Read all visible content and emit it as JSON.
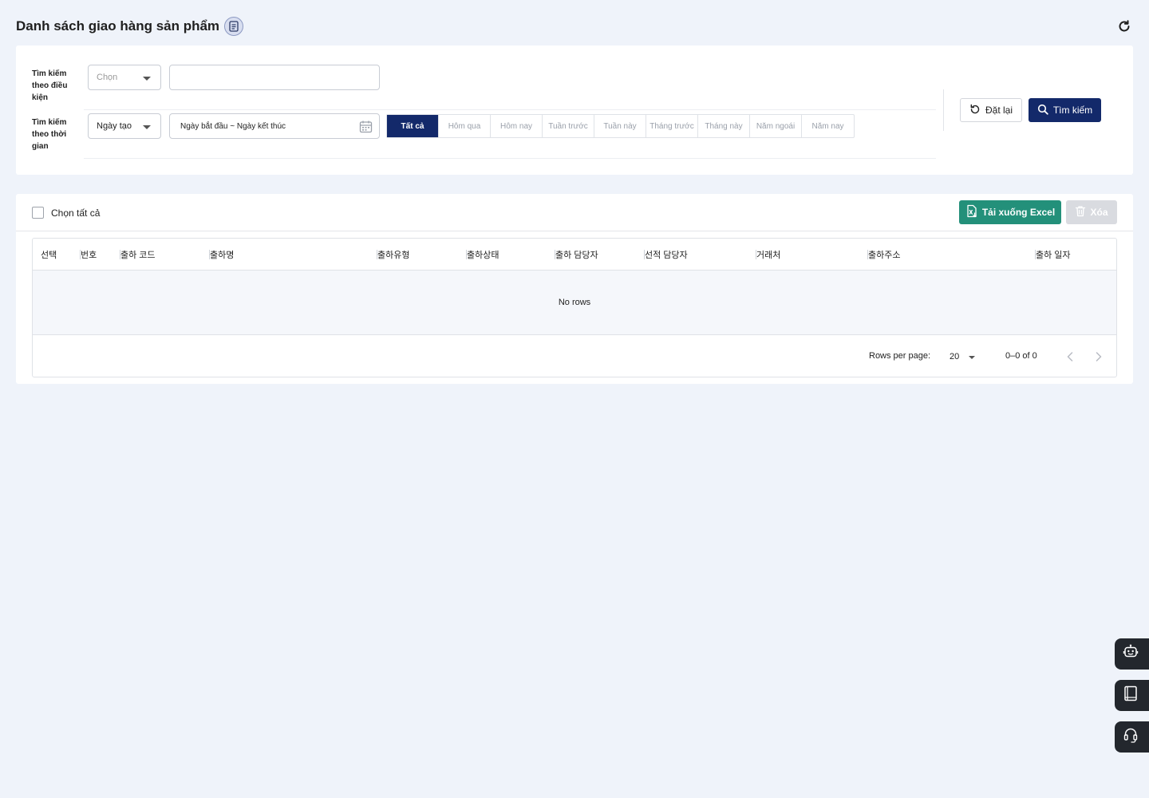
{
  "header": {
    "title": "Danh sách giao hàng sản phẩm"
  },
  "filters": {
    "condition": {
      "label": "Tìm kiếm theo điều kiện",
      "select_value": "Chọn",
      "input_value": ""
    },
    "time": {
      "label": "Tìm kiếm theo thời gian",
      "select_value": "Ngày tạo",
      "date_range": "Ngày bắt đầu ~ Ngày kết thúc",
      "ranges": [
        "Tất cả",
        "Hôm qua",
        "Hôm nay",
        "Tuần trước",
        "Tuần này",
        "Tháng trước",
        "Tháng này",
        "Năm ngoái",
        "Năm nay"
      ],
      "active_range": "Tất cả"
    },
    "reset_label": "Đặt lại",
    "search_label": "Tìm kiếm"
  },
  "toolbar": {
    "select_all_label": "Chọn tất cả",
    "excel_label": "Tải xuống Excel",
    "delete_label": "Xóa"
  },
  "table": {
    "columns": [
      "선택",
      "번호",
      "출하 코드",
      "출하명",
      "출하유형",
      "출하상태",
      "출하 담당자",
      "선적 담당자",
      "거래처",
      "출하주소",
      "출하 일자"
    ],
    "empty_text": "No rows",
    "rows": []
  },
  "pagination": {
    "rows_per_page_label": "Rows per page:",
    "rows_per_page": "20",
    "range_text": "0–0 of 0"
  },
  "colors": {
    "primary": "#13296a",
    "excel": "#23907a",
    "background": "#eff3fa",
    "floating": "#23272d"
  }
}
